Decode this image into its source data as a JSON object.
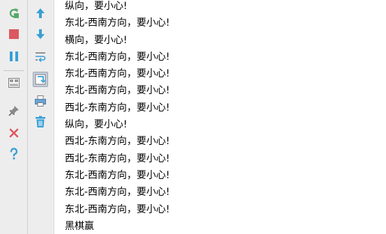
{
  "console": {
    "lines": [
      "纵向，要小心!",
      "东北-西南方向，要小心!",
      "横向，要小心!",
      "东北-西南方向，要小心!",
      "东北-西南方向，要小心!",
      "东北-西南方向，要小心!",
      "西北-东南方向，要小心!",
      "纵向，要小心!",
      "西北-东南方向，要小心!",
      "西北-东南方向，要小心!",
      "东北-西南方向，要小心!",
      "东北-西南方向，要小心!",
      "东北-西南方向，要小心!",
      "黑棋赢"
    ]
  },
  "toolbar_left": {
    "icons": [
      "rerun-icon",
      "stop-icon",
      "pause-icon",
      "layout-icon",
      "pin-icon",
      "close-icon",
      "help-icon"
    ]
  },
  "toolbar_right": {
    "icons": [
      "up-arrow-icon",
      "down-arrow-icon",
      "soft-wrap-icon",
      "scroll-to-end-icon",
      "print-icon",
      "trash-icon"
    ]
  },
  "colors": {
    "toolbar_bg": "#ededed",
    "green": "#59a869",
    "red": "#db5860",
    "blue": "#389fd6",
    "text": "#000000"
  }
}
